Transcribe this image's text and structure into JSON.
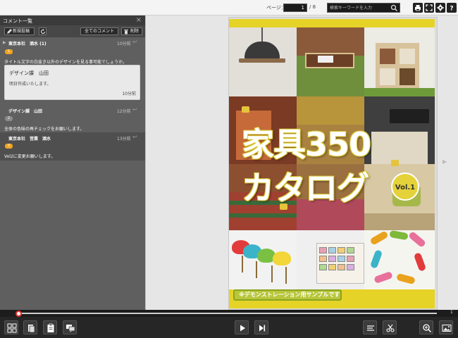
{
  "toolbar": {
    "page_label": "ページ：",
    "current_page": "1",
    "total_pages": "/ 8",
    "search_placeholder": "検索キーワードを入力"
  },
  "sidebar": {
    "title": "コメント一覧",
    "new_post_label": "新規投稿",
    "all_comments_label": "全てのコメント",
    "delete_label": "削除",
    "threads": [
      {
        "author": "東京本社　酒水 (1)",
        "time": "10分前",
        "badge": "1",
        "message": "タイトル文字の白抜き以外のデザインを見る事可能でしょうか。",
        "reply": {
          "author": "デザイン課　山田",
          "message": "明日作成いたします。",
          "time": "10分前"
        }
      },
      {
        "author": "デザイン課　山田",
        "time": "12分前",
        "badge": "2",
        "message": "全体の色味の再チェックをお願いします。"
      },
      {
        "author": "東京本社　営業　酒水",
        "time": "13分前",
        "badge": "3",
        "message": "Vol2に変更お願いします。"
      }
    ]
  },
  "cover": {
    "title_line1": "家具350",
    "title_line2": "カタログ",
    "volume": "Vol.1",
    "demo_notice": "※デモンストレーション用サンプルです"
  },
  "timeline": {
    "total": "1"
  },
  "colors": {
    "accent_red": "#e0342f",
    "badge_orange": "#f0a51f",
    "badge_grey": "#8a8a8a",
    "cover_yellow": "#e6d327"
  },
  "icons": [
    "pen-icon",
    "refresh-icon",
    "trash-icon",
    "search-icon",
    "print-icon",
    "fullscreen-icon",
    "gear-icon",
    "help-icon",
    "grid-icon",
    "pages-icon",
    "clipboard-icon",
    "comment-icon",
    "play-icon",
    "skip-icon",
    "sort-icon",
    "scissors-icon",
    "zoom-icon",
    "image-icon"
  ]
}
